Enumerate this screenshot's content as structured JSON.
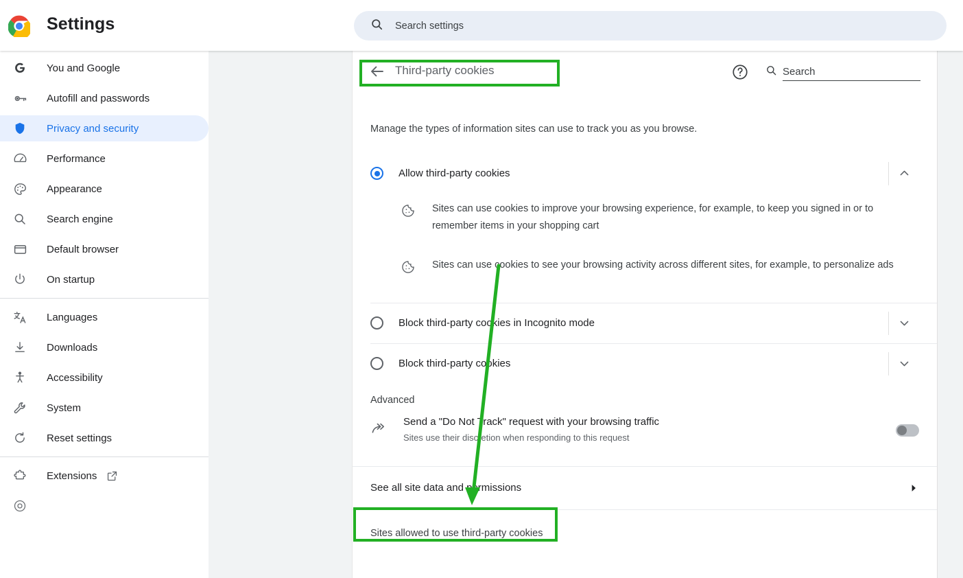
{
  "toolbar": {
    "app_title": "Settings",
    "logo_icon": "chrome-logo",
    "search_icon": "search-icon",
    "search_placeholder": "Search settings",
    "search_value": ""
  },
  "sidebar": {
    "items": [
      {
        "label": "You and Google",
        "icon": "google-g-icon",
        "selected": false
      },
      {
        "label": "Autofill and passwords",
        "icon": "key-icon",
        "selected": false
      },
      {
        "label": "Privacy and security",
        "icon": "shield-icon",
        "selected": true
      },
      {
        "label": "Performance",
        "icon": "speedometer-icon",
        "selected": false
      },
      {
        "label": "Appearance",
        "icon": "palette-icon",
        "selected": false
      },
      {
        "label": "Search engine",
        "icon": "magnifier-icon",
        "selected": false
      },
      {
        "label": "Default browser",
        "icon": "browser-window-icon",
        "selected": false
      },
      {
        "label": "On startup",
        "icon": "power-icon",
        "selected": false
      }
    ],
    "items_group2": [
      {
        "label": "Languages",
        "icon": "translate-icon",
        "selected": false
      },
      {
        "label": "Downloads",
        "icon": "download-icon",
        "selected": false
      },
      {
        "label": "Accessibility",
        "icon": "accessibility-icon",
        "selected": false
      },
      {
        "label": "System",
        "icon": "wrench-icon",
        "selected": false
      },
      {
        "label": "Reset settings",
        "icon": "restore-icon",
        "selected": false
      }
    ],
    "items_group3": [
      {
        "label": "Extensions",
        "icon": "puzzle-icon",
        "external_icon": "external-link-icon",
        "selected": false
      }
    ]
  },
  "page": {
    "back_icon": "back-arrow-icon",
    "title": "Third-party cookies",
    "help_icon": "help-circle-icon",
    "search_icon": "magnifier-icon",
    "search_placeholder": "Search",
    "search_value": "",
    "description": "Manage the types of information sites can use to track you as you browse.",
    "options": [
      {
        "label": "Allow third-party cookies",
        "selected": true,
        "expanded": true,
        "chevron": "chevron-up-icon",
        "details": [
          {
            "icon": "cookie-icon",
            "text": "Sites can use cookies to improve your browsing experience, for example, to keep you signed in or to remember items in your shopping cart"
          },
          {
            "icon": "cookie-icon",
            "text": "Sites can use cookies to see your browsing activity across different sites, for example, to personalize ads"
          }
        ]
      },
      {
        "label": "Block third-party cookies in Incognito mode",
        "selected": false,
        "expanded": false,
        "chevron": "chevron-down-icon",
        "details": []
      },
      {
        "label": "Block third-party cookies",
        "selected": false,
        "expanded": false,
        "chevron": "chevron-down-icon",
        "details": []
      }
    ],
    "advanced": {
      "heading": "Advanced",
      "dnt": {
        "icon": "do-not-track-arrow-icon",
        "title": "Send a \"Do Not Track\" request with your browsing traffic",
        "subtitle": "Sites use their discretion when responding to this request",
        "toggle_on": false
      }
    },
    "site_data_link": {
      "label": "See all site data and permissions",
      "arrow_icon": "chevron-right-icon"
    },
    "allowed_sites_heading": "Sites allowed to use third-party cookies"
  },
  "annotations": {
    "color": "#22b024",
    "box_title": "Third-party cookies",
    "box_link": "See all site data and permissions",
    "arrow_from": "cookie-detail-2",
    "arrow_to": "see-all-site-data-and-permissions"
  }
}
